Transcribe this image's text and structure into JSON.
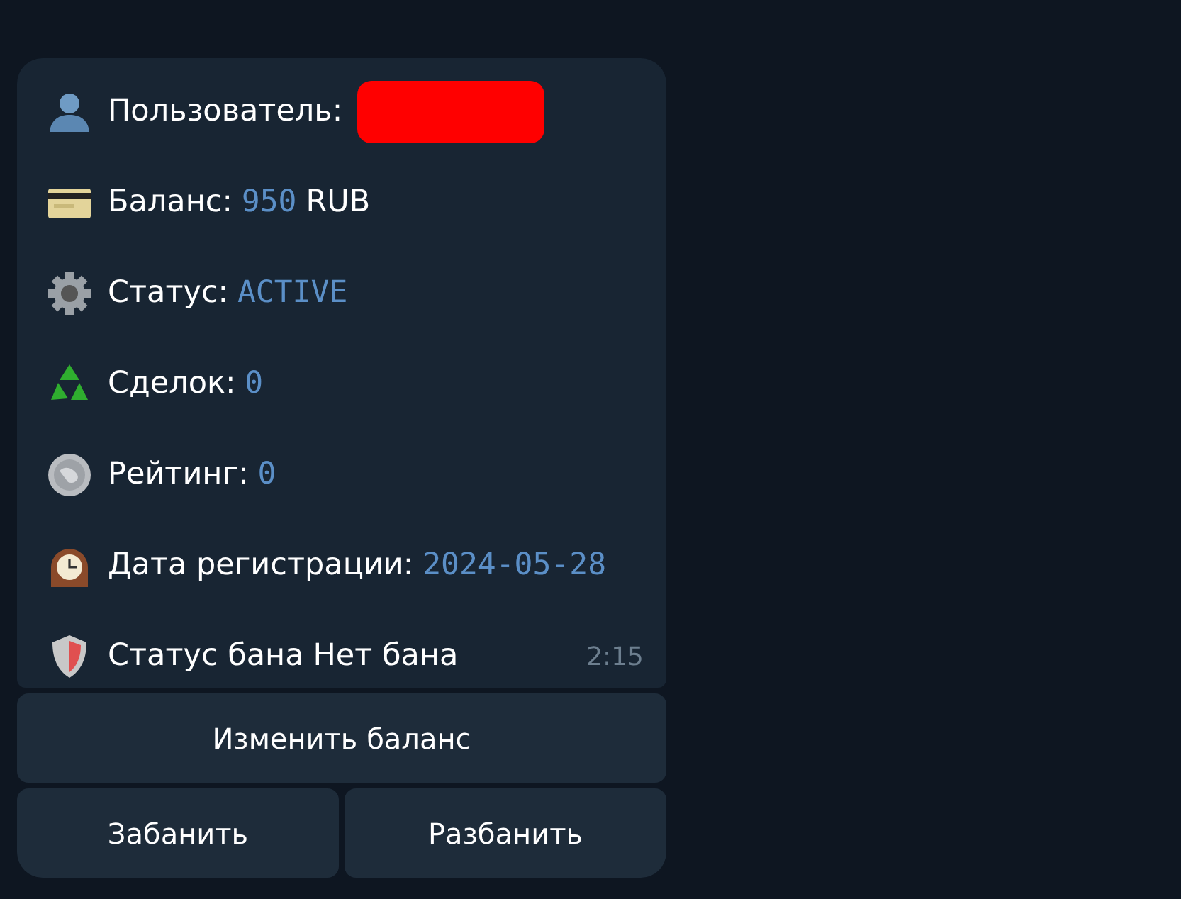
{
  "message": {
    "rows": [
      {
        "label": "Пользователь:",
        "parts": [],
        "redacted": true
      },
      {
        "label": "Баланс:",
        "parts": [
          {
            "text": "950",
            "kind": "code"
          },
          {
            "text": "RUB",
            "kind": "plain"
          }
        ]
      },
      {
        "label": "Статус:",
        "parts": [
          {
            "text": "ACTIVE",
            "kind": "code"
          }
        ]
      },
      {
        "label": "Сделок:",
        "parts": [
          {
            "text": "0",
            "kind": "code"
          }
        ]
      },
      {
        "label": "Рейтинг:",
        "parts": [
          {
            "text": "0",
            "kind": "code"
          }
        ]
      },
      {
        "label": "Дата регистрации:",
        "parts": [
          {
            "text": "2024-05-28",
            "kind": "code"
          }
        ]
      },
      {
        "label": "Статус бана",
        "parts": [
          {
            "text": "Нет бана",
            "kind": "plain"
          }
        ]
      }
    ],
    "time": "2:15"
  },
  "keyboard": [
    [
      "Изменить баланс"
    ],
    [
      "Забанить",
      "Разбанить"
    ]
  ]
}
